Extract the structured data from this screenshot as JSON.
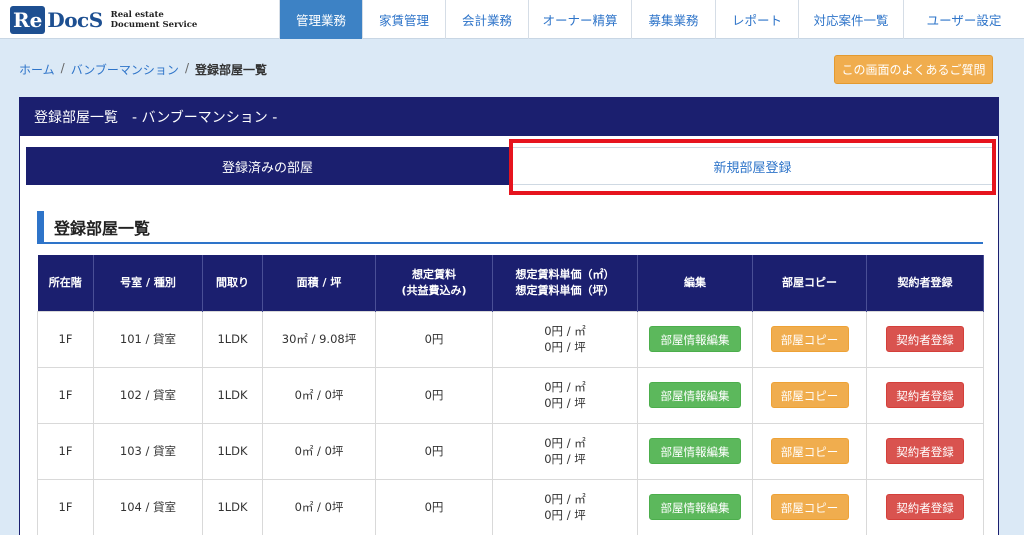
{
  "logo": {
    "mark": "Re",
    "word": "DocS",
    "line1": "Real estate",
    "line2": "Document Service"
  },
  "nav": [
    {
      "label": "管理業務",
      "active": true
    },
    {
      "label": "家賃管理"
    },
    {
      "label": "会計業務"
    },
    {
      "label": "オーナー精算"
    },
    {
      "label": "募集業務"
    },
    {
      "label": "レポート"
    },
    {
      "label": "対応案件一覧"
    },
    {
      "label": "ユーザー設定"
    }
  ],
  "breadcrumb": {
    "home": "ホーム",
    "sep": "/",
    "property": "バンブーマンション",
    "current": "登録部屋一覧"
  },
  "faq_button": "この画面のよくあるご質問",
  "panel": {
    "title": "登録部屋一覧　- バンブーマンション -"
  },
  "tabs": {
    "registered": "登録済みの部屋",
    "new": "新規部屋登録"
  },
  "section_title": "登録部屋一覧",
  "table": {
    "headers": {
      "floor": "所在階",
      "room": "号室 / 種別",
      "layout": "間取り",
      "area": "面積 / 坪",
      "rent_l1": "想定賃料",
      "rent_l2": "(共益費込み)",
      "unit_l1": "想定賃料単価（㎡）",
      "unit_l2": "想定賃料単価（坪）",
      "edit": "編集",
      "copy": "部屋コピー",
      "contract": "契約者登録"
    },
    "rows": [
      {
        "floor": "1F",
        "room": "101 / 貸室",
        "layout": "1LDK",
        "area": "30㎡ / 9.08坪",
        "rent": "0円",
        "unit_m2": "0円 / ㎡",
        "unit_tsubo": "0円 / 坪",
        "edit": "部屋情報編集",
        "copy": "部屋コピー",
        "contract": "契約者登録"
      },
      {
        "floor": "1F",
        "room": "102 / 貸室",
        "layout": "1LDK",
        "area": "0㎡ / 0坪",
        "rent": "0円",
        "unit_m2": "0円 / ㎡",
        "unit_tsubo": "0円 / 坪",
        "edit": "部屋情報編集",
        "copy": "部屋コピー",
        "contract": "契約者登録"
      },
      {
        "floor": "1F",
        "room": "103 / 貸室",
        "layout": "1LDK",
        "area": "0㎡ / 0坪",
        "rent": "0円",
        "unit_m2": "0円 / ㎡",
        "unit_tsubo": "0円 / 坪",
        "edit": "部屋情報編集",
        "copy": "部屋コピー",
        "contract": "契約者登録"
      },
      {
        "floor": "1F",
        "room": "104 / 貸室",
        "layout": "1LDK",
        "area": "0㎡ / 0坪",
        "rent": "0円",
        "unit_m2": "0円 / ㎡",
        "unit_tsubo": "0円 / 坪",
        "edit": "部屋情報編集",
        "copy": "部屋コピー",
        "contract": "契約者登録"
      }
    ]
  },
  "colors": {
    "navy": "#1b1f6f",
    "accent_blue": "#3d82c5",
    "highlight_red": "#e6141e"
  }
}
